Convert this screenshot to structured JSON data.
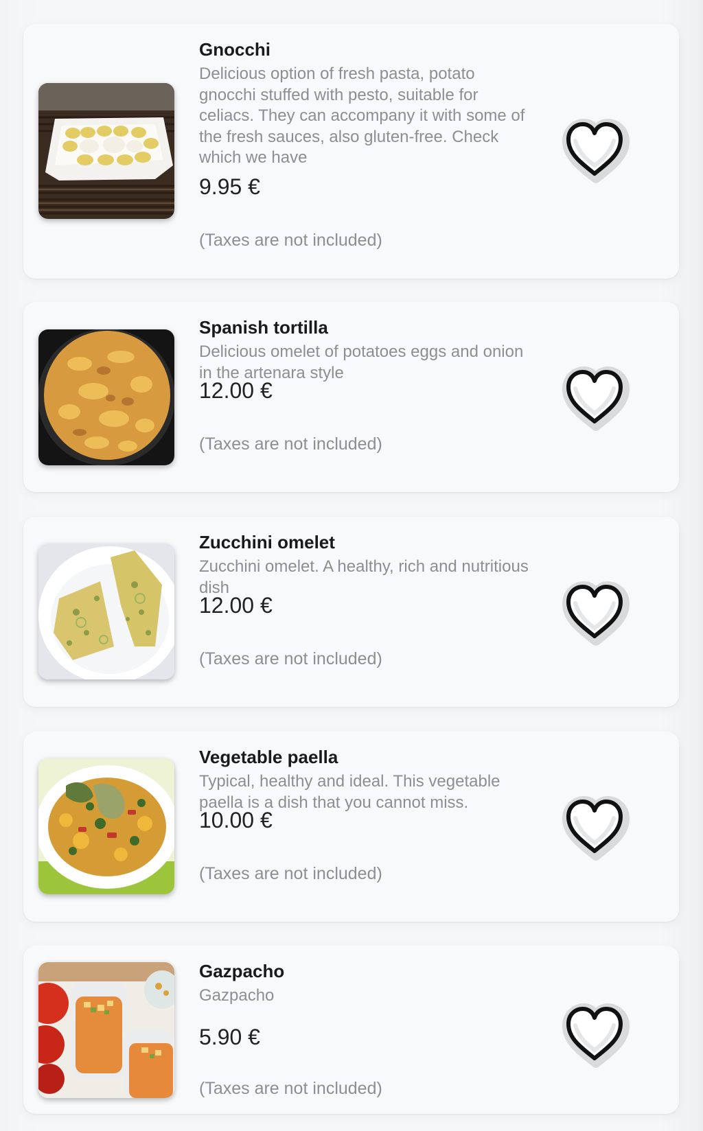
{
  "menu": {
    "items": [
      {
        "name": "Gnocchi",
        "description": "Delicious option of fresh pasta, potato gnocchi stuffed with pesto, suitable for celiacs. They can accompany it with some of the fresh sauces, also gluten-free. Check which we have",
        "price": "9.95 €",
        "taxes_note": "(Taxes are not included)",
        "favorite_icon": "heart-outline-icon"
      },
      {
        "name": "Spanish tortilla",
        "description": "Delicious omelet of potatoes eggs and onion in the artenara style",
        "price": "12.00 €",
        "taxes_note": "(Taxes are not included)",
        "favorite_icon": "heart-outline-icon"
      },
      {
        "name": "Zucchini omelet",
        "description": "Zucchini omelet. A healthy, rich and nutritious dish",
        "price": "12.00 €",
        "taxes_note": "(Taxes are not included)",
        "favorite_icon": "heart-outline-icon"
      },
      {
        "name": "Vegetable paella",
        "description": "Typical, healthy and ideal. This vegetable paella is a dish that you cannot miss.",
        "price": "10.00 €",
        "taxes_note": "(Taxes are not included)",
        "favorite_icon": "heart-outline-icon"
      },
      {
        "name": "Gazpacho",
        "description": "Gazpacho",
        "price": "5.90 €",
        "taxes_note": "(Taxes are not included)",
        "favorite_icon": "heart-outline-icon"
      }
    ]
  },
  "colors": {
    "card_background": "#f8f9fb",
    "title_text": "#1a1a1a",
    "secondary_text": "#8b8f94",
    "heart_stroke": "#111111"
  }
}
